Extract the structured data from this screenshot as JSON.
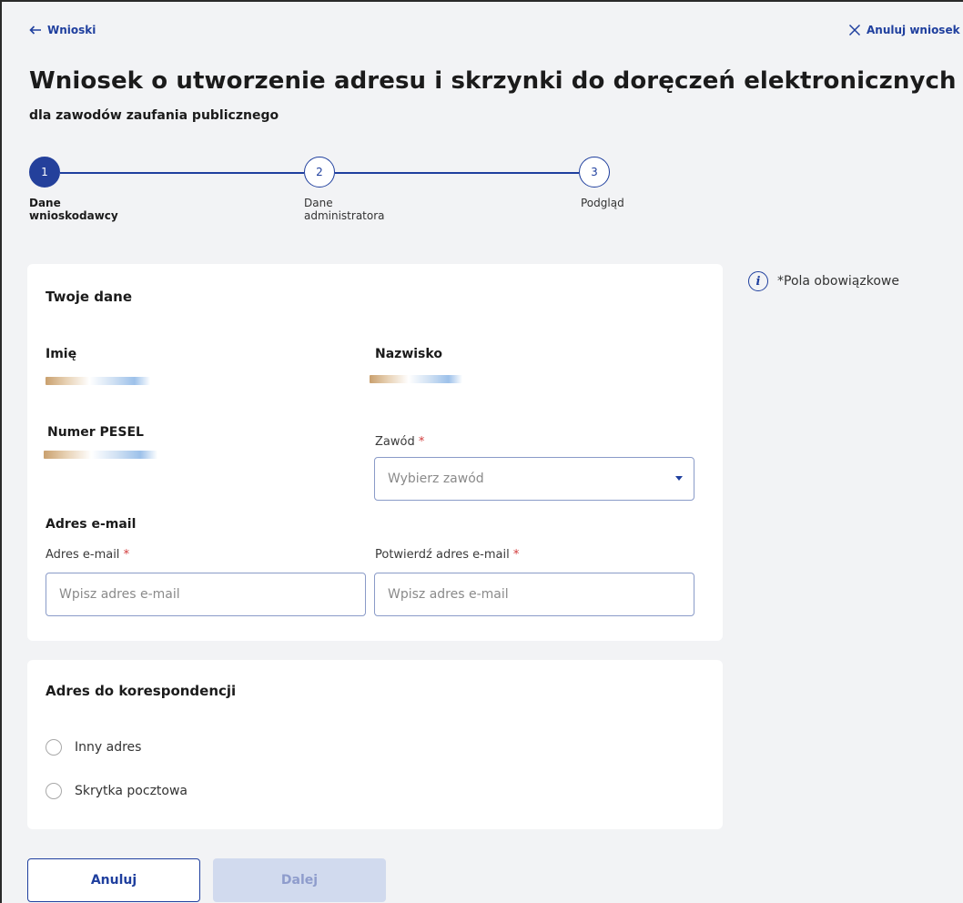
{
  "nav": {
    "back_label": "Wnioski",
    "cancel_label": "Anuluj wniosek"
  },
  "header": {
    "title": "Wniosek o utworzenie adresu i skrzynki do doręczeń elektronicznych",
    "subtitle": "dla zawodów zaufania publicznego"
  },
  "stepper": {
    "steps": [
      {
        "number": "1",
        "line1": "Dane",
        "line2": "wnioskodawcy",
        "state": "active"
      },
      {
        "number": "2",
        "line1": "Dane",
        "line2": "administratora",
        "state": "todo"
      },
      {
        "number": "3",
        "line1": "Podgląd",
        "line2": "",
        "state": "todo"
      }
    ]
  },
  "info": {
    "required_note": "*Pola obowiązkowe"
  },
  "personal": {
    "title": "Twoje dane",
    "first_name_label": "Imię",
    "last_name_label": "Nazwisko",
    "pesel_label": "Numer PESEL",
    "profession_label": "Zawód",
    "required_marker": "*",
    "profession_placeholder": "Wybierz zawód",
    "email_section_title": "Adres e-mail",
    "email_label": "Adres e-mail",
    "email_placeholder": "Wpisz adres e-mail",
    "confirm_email_label": "Potwierdź adres e-mail",
    "confirm_email_placeholder": "Wpisz adres e-mail"
  },
  "correspondence": {
    "title": "Adres do korespondencji",
    "options": [
      "Inny adres",
      "Skrytka pocztowa"
    ]
  },
  "actions": {
    "cancel_label": "Anuluj",
    "next_label": "Dalej"
  },
  "colors": {
    "accent": "#1f3f9e",
    "active_step": "#24409b",
    "disabled_button": "#d1daee",
    "required": "#d23b3b",
    "background": "#f2f3f5"
  }
}
